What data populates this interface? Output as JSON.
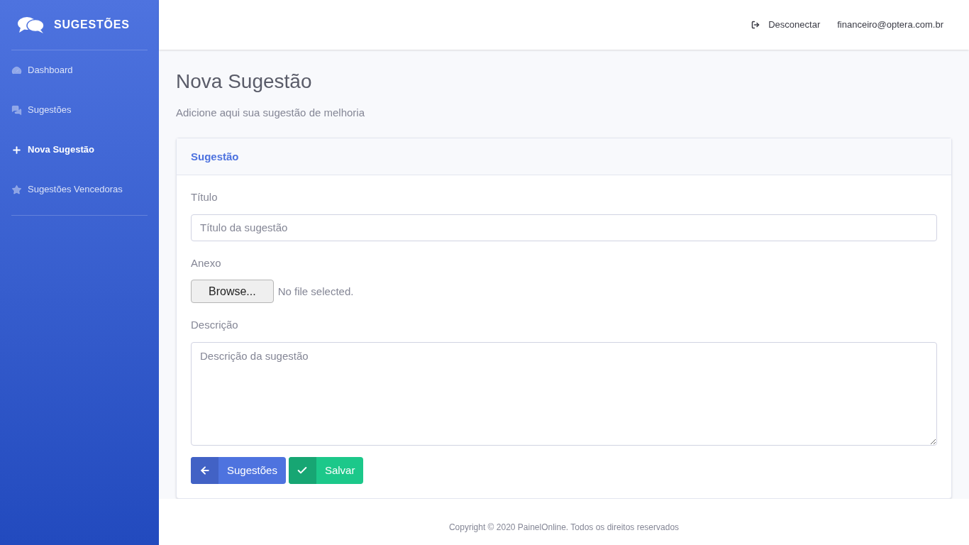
{
  "sidebar": {
    "brand": "SUGESTÕES",
    "items": [
      {
        "label": "Dashboard",
        "selected": false
      },
      {
        "label": "Sugestões",
        "selected": false
      },
      {
        "label": "Nova Sugestão",
        "selected": true
      },
      {
        "label": "Sugestões Vencedoras",
        "selected": false
      }
    ]
  },
  "topbar": {
    "logout": "Desconectar",
    "user": "financeiro@optera.com.br"
  },
  "page": {
    "title": "Nova Sugestão",
    "subtitle": "Adicione aqui sua sugestão de melhoria"
  },
  "card": {
    "header": "Sugestão",
    "title_label": "Título",
    "title_placeholder": "Título da sugestão",
    "file_label": "Anexo",
    "browse": "Browse...",
    "file_status": "No file selected.",
    "desc_label": "Descrição",
    "desc_placeholder": "Descrição da sugestão",
    "buttons": [
      {
        "label": "Sugestões",
        "kind": "back"
      },
      {
        "label": "Salvar",
        "kind": "save"
      }
    ]
  },
  "footer": "Copyright © 2020 PainelOnline. Todos os direitos reservados"
}
